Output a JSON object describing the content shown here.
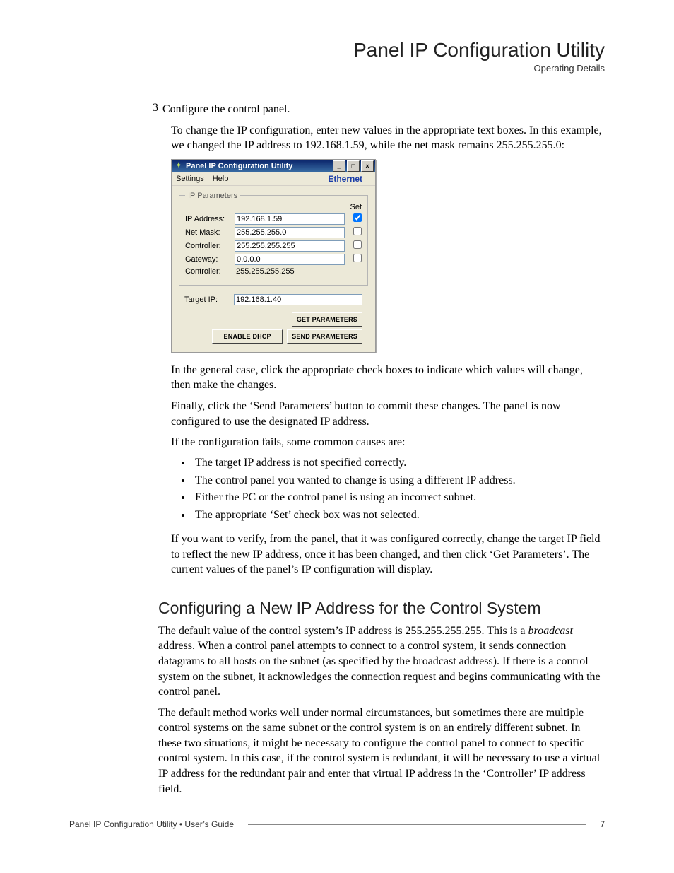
{
  "header": {
    "title": "Panel IP Configuration Utility",
    "subtitle": "Operating Details"
  },
  "step": {
    "number": "3",
    "text": "Configure the control panel."
  },
  "intro": "To change the IP configuration, enter new values in the appropriate text boxes. In this example, we changed the IP address to 192.168.1.59, while the net mask remains 255.255.255.0:",
  "app": {
    "title": "Panel IP Configuration Utility",
    "menu": {
      "settings": "Settings",
      "help": "Help",
      "ethernet": "Ethernet"
    },
    "group_legend": "IP Parameters",
    "set_label": "Set",
    "rows": {
      "ip": {
        "label": "IP Address:",
        "value": "192.168.1.59",
        "checked": true
      },
      "mask": {
        "label": "Net Mask:",
        "value": "255.255.255.0",
        "checked": false
      },
      "ctrl": {
        "label": "Controller:",
        "value": "255.255.255.255",
        "checked": false
      },
      "gw": {
        "label": "Gateway:",
        "value": "0.0.0.0",
        "checked": false
      },
      "ctrl_ro": {
        "label": "Controller:",
        "value": "255.255.255.255"
      }
    },
    "target": {
      "label": "Target IP:",
      "value": "192.168.1.40"
    },
    "buttons": {
      "get": "GET PARAMETERS",
      "dhcp": "ENABLE DHCP",
      "send": "SEND PARAMETERS"
    }
  },
  "para_after_shot_1": "In the general case, click the appropriate check boxes to indicate which values will change, then make the changes.",
  "para_after_shot_2": "Finally, click the ‘Send Parameters’ button to commit these changes. The panel is now configured to use the designated IP address.",
  "para_fail_intro": "If the configuration fails, some common causes are:",
  "fail_bullets": [
    "The target IP address is not specified correctly.",
    "The control panel you wanted to change is using a different IP address.",
    "Either the PC or the control panel is using an incorrect subnet.",
    "The appropriate ‘Set’ check box was not selected."
  ],
  "para_verify": "If you want to verify, from the panel, that it was configured correctly, change the target IP field to reflect the new IP address, once it has been changed, and then click ‘Get Parameters’. The current values of the panel’s IP configuration will display.",
  "section2": {
    "heading": "Configuring a New IP Address for the Control System",
    "p1a": "The default value of the control system’s IP address is 255.255.255.255. This is a ",
    "p1_em": "broadcast",
    "p1b": " address. When a control panel attempts to connect to a control system, it sends connection datagrams to all hosts on the subnet (as specified by the broadcast address). If there is a control system on the subnet, it acknowledges the connection request and begins communicating with the control panel.",
    "p2": "The default method works well under normal circumstances, but sometimes there are multiple control systems on the same subnet or the control system is on an entirely different subnet. In these two situations, it might be necessary to configure the control panel to connect to specific control system. In this case, if the control system is redundant, it will be necessary to use a virtual IP address for the redundant pair and enter that virtual IP address in the ‘Controller’ IP address field."
  },
  "footer": {
    "left_a": "Panel IP Configuration Utility",
    "bullet": "•",
    "left_b": "User’s Guide",
    "page": "7"
  }
}
